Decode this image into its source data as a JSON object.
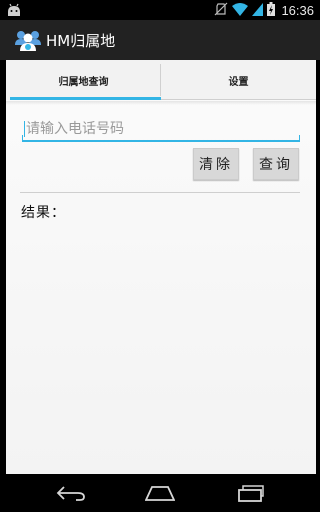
{
  "status_bar": {
    "time": "16:36",
    "icons": [
      "android-debug-icon",
      "no-sim-icon",
      "wifi-icon",
      "signal-icon",
      "battery-charging-icon"
    ]
  },
  "action_bar": {
    "title": "HM归属地",
    "icon": "people-group-icon"
  },
  "tabs": [
    {
      "label": "归属地查询",
      "active": true
    },
    {
      "label": "设置",
      "active": false
    }
  ],
  "search": {
    "placeholder": "请输入电话号码",
    "value": ""
  },
  "buttons": {
    "clear_label": "清除",
    "query_label": "查询"
  },
  "result": {
    "label": "结果："
  },
  "nav_bar": {
    "icons": [
      "back-icon",
      "home-icon",
      "recent-apps-icon"
    ]
  },
  "colors": {
    "accent": "#33b5e5",
    "action_bar": "#222222",
    "background": "#f6f6f6"
  }
}
